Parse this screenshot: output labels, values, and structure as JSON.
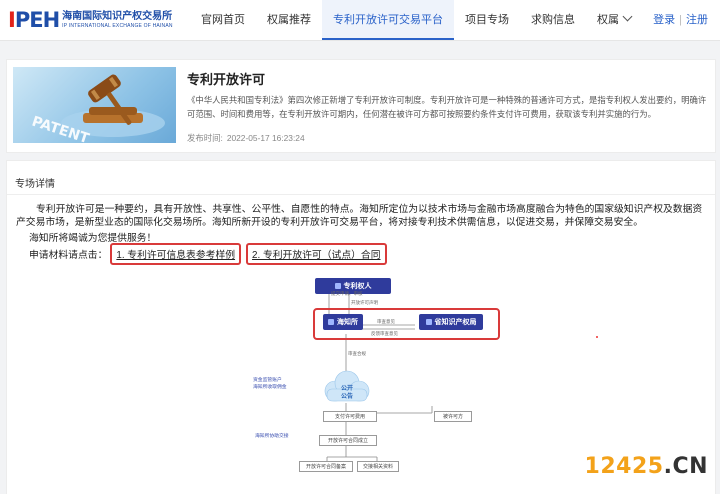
{
  "header": {
    "logo_mark": "IPEH",
    "logo_name_cn": "海南国际知识产权交易所",
    "logo_name_en": "IP INTERNATIONAL EXCHANGE OF HAINAN",
    "nav": [
      {
        "label": "官网首页",
        "active": false
      },
      {
        "label": "权属推荐",
        "active": false
      },
      {
        "label": "专利开放许可交易平台",
        "active": true
      },
      {
        "label": "项目专场",
        "active": false
      },
      {
        "label": "求购信息",
        "active": false
      },
      {
        "label": "权属",
        "active": false,
        "dropdown": true
      }
    ],
    "login_label": "登录",
    "register_label": "注册",
    "accent_color": "#2a62c9"
  },
  "intro_card": {
    "title": "专利开放许可",
    "description": "《中华人民共和国专利法》第四次修正新增了专利开放许可制度。专利开放许可是一种特殊的普通许可方式，是指专利权人发出要约，明确许可范围、时间和费用等，在专利开放许可期内，任何潜在被许可方都可按照要约条件支付许可费用，获取该专利并实施的行为。",
    "publish_label": "发布时间:",
    "publish_time": "2022-05-17 16:23:24",
    "image_label": "PATENT"
  },
  "detail": {
    "section_title": "专场详情",
    "paragraph": "专利开放许可是一种要约，具有开放性、共享性、公平性、自愿性的特点。海知所定位为以技术市场与金融市场高度融合为特色的国家级知识产权及数据资产交易市场，是新型业态的国际化交易场所。海知所新开设的专利开放许可交易平台，将对接专利技术供需信息，以促进交易，并保障交易安全。",
    "notice": "海知所将竭诚为您提供服务！",
    "apply_prefix": "申请材料请点击：",
    "links": [
      "1. 专利许可信息表参考样例",
      "2. 专利开放许可（试点）合同"
    ]
  },
  "flow": {
    "patentee": "专利权人",
    "exchange": "海知所",
    "province_ip": "省知识产权局",
    "cloud_line1": "公开",
    "cloud_line2": "公告",
    "pay_fee": "支付许可费用",
    "licensee": "被许可方",
    "contract": "开放许可合同成立",
    "record": "开放许可合同备案",
    "handover": "交接相关资料",
    "label_declare": "开放许可声明",
    "label_apply": "提交申请、审核",
    "label_review": "审查意见",
    "label_feedback": "反馈审查意见",
    "label_handover_submit": "提交审查",
    "label_notice": "审查合规",
    "side_label_1": "资金监管账户",
    "side_label_2": "海知所收取佣金",
    "side_label_3": "海知所协助交接"
  },
  "watermark": {
    "num": "12425",
    "dot": ".",
    "suffix": "CN"
  }
}
